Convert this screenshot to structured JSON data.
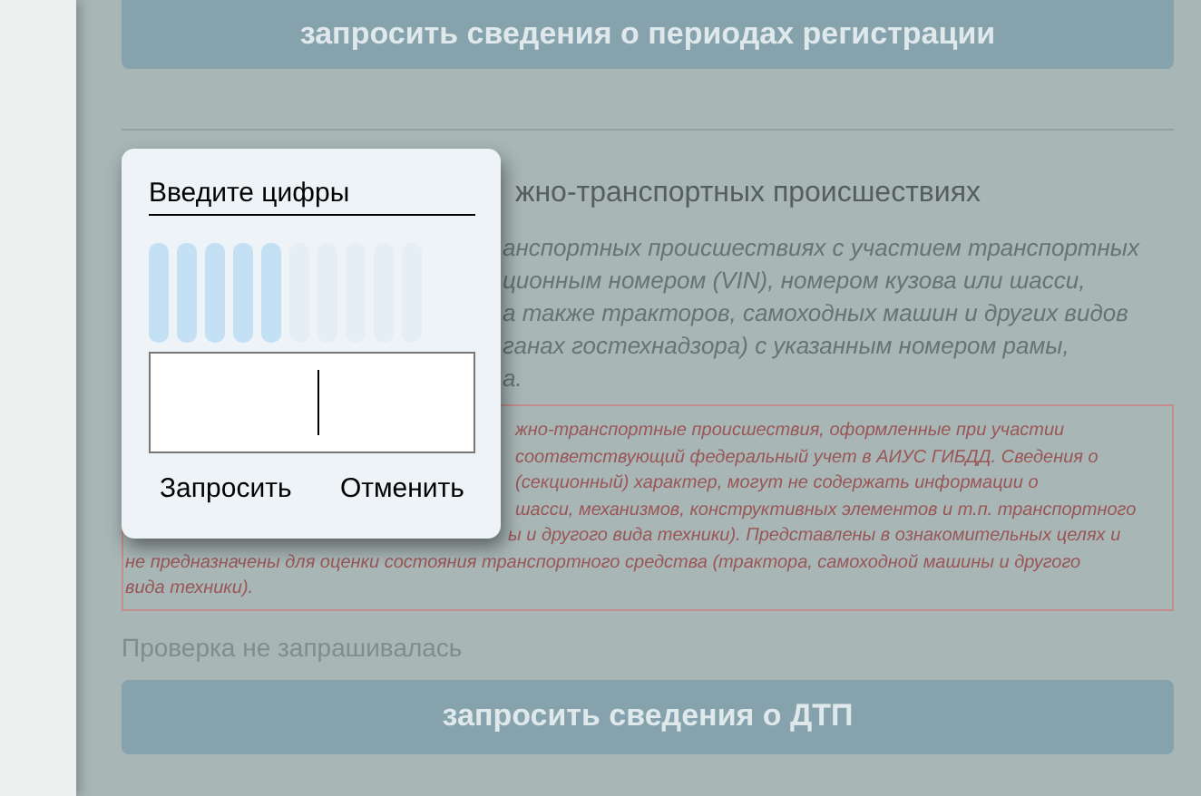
{
  "page": {
    "register_button": "запросить сведения о периодах регистрации",
    "accidents_heading": "жно-транспортных происшествиях",
    "accidents_description": [
      "анспортных происшествиях с участием транспортных",
      "ционным номером (VIN), номером кузова или шасси,",
      "а также тракторов, самоходных машин и других видов",
      "ганах гостехнадзора) с указанным номером рамы,",
      "а."
    ],
    "notice_lines": [
      "жно-транспортные происшествия, оформленные при участии",
      "соответствующий федеральный учет в АИУС ГИБДД. Сведения о",
      "(секционный) характер, могут не содержать информации о",
      "шасси, механизмов, конструктивных элементов и т.п. транспортного",
      "ы и другого вида техники). Представлены в ознакомительных целях и"
    ],
    "notice_full_lines": [
      "не предназначены для оценки состояния транспортного средства (трактора, самоходной машины и другого",
      "вида техники)."
    ],
    "status": "Проверка не запрашивалась",
    "accidents_button": "запросить сведения о ДТП"
  },
  "captcha_dialog": {
    "title": "Введите цифры",
    "buttons": [
      "Запросить",
      "Отменить"
    ]
  }
}
